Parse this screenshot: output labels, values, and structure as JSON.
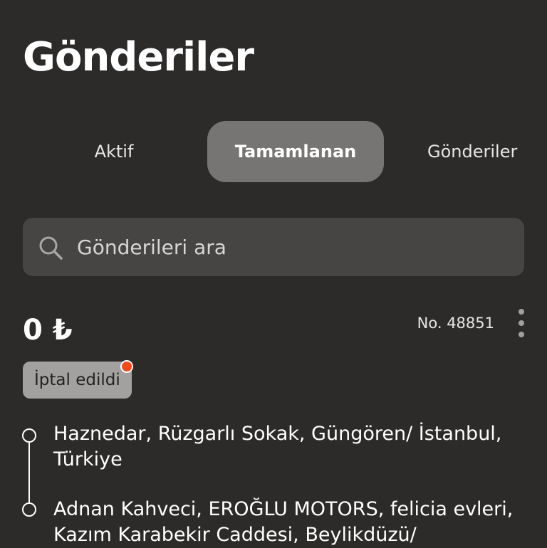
{
  "page": {
    "title": "Gönderiler"
  },
  "tabs": [
    {
      "label": "Aktif",
      "active": false
    },
    {
      "label": "Tamamlanan",
      "active": true
    },
    {
      "label": "Gönderiler",
      "active": false
    }
  ],
  "search": {
    "placeholder": "Gönderileri ara",
    "icon": "search-icon"
  },
  "shipment": {
    "price": "0 ₺",
    "number": "No. 48851",
    "status": "İptal edildi",
    "status_dot_color": "#f24a1d",
    "from_address": "Haznedar, Rüzgarlı Sokak, Güngören/ İstanbul, Türkiye",
    "to_address": "Adnan Kahveci, EROĞLU MOTORS, felicia evleri, Kazım Karabekir Caddesi, Beylikdüzü/"
  },
  "colors": {
    "background": "#2d2b2a",
    "active_tab": "#777574",
    "search_bg": "#474543",
    "badge_bg": "#a3a1a0"
  }
}
